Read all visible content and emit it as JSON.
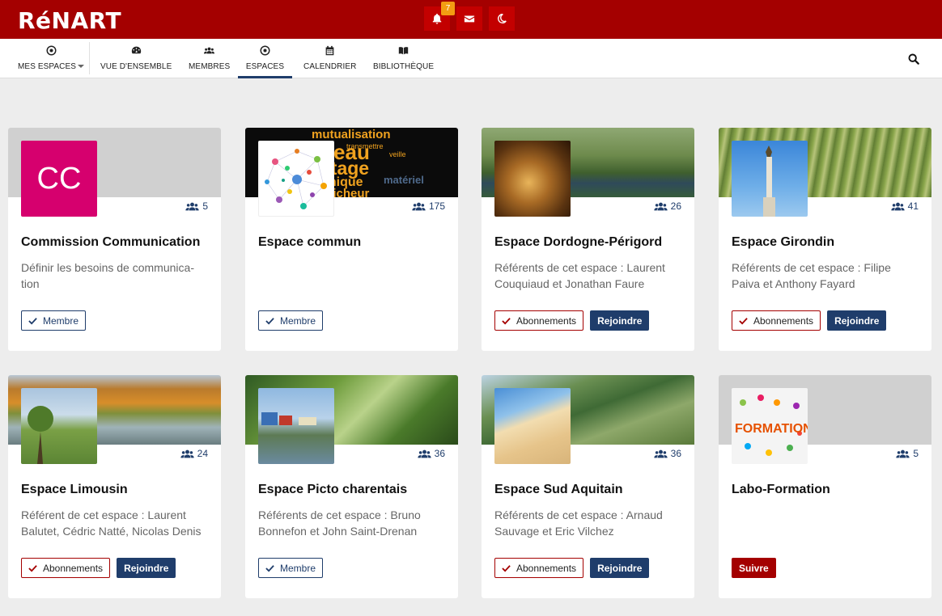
{
  "header": {
    "logo": "RéNART",
    "notifications_count": "7",
    "icons": [
      "bell-icon",
      "envelope-icon",
      "moon-icon",
      "search-icon"
    ]
  },
  "nav": {
    "mes_espaces": "MES ESPACES",
    "vue": "VUE D'ENSEMBLE",
    "membres": "MEMBRES",
    "espaces": "ESPACES",
    "calendrier": "CALENDRIER",
    "bibliotheque": "BIBLIOTHÈQUE"
  },
  "colors": {
    "brand_red": "#a40000",
    "navy": "#1f3d6b",
    "badge": "#f39c12"
  },
  "cards": [
    {
      "title": "Commission Communication",
      "count": "5",
      "initials": "CC",
      "desc": "Définir les besoins de communica-tion",
      "membre": "Membre"
    },
    {
      "title": "Espace commun",
      "count": "175",
      "membre": "Membre",
      "words": [
        "mutualisation",
        "transmettre",
        "réseau",
        "veille",
        "partage",
        "technique",
        "matériel",
        "défricheur"
      ]
    },
    {
      "title": "Espace Dordogne-Périgord",
      "count": "26",
      "desc": "Référents de cet espace : Laurent Couquiaud et Jonathan Faure",
      "abonnements": "Abonnements",
      "rejoindre": "Rejoindre"
    },
    {
      "title": "Espace Girondin",
      "count": "41",
      "desc": "Référents de cet espace : Filipe Paiva et Anthony Fayard",
      "abonnements": "Abonnements",
      "rejoindre": "Rejoindre"
    },
    {
      "title": "Espace Limousin",
      "count": "24",
      "desc": "Référent de cet espace : Laurent Balutet, Cédric Natté, Nicolas Denis",
      "abonnements": "Abonnements",
      "rejoindre": "Rejoindre"
    },
    {
      "title": "Espace Picto charentais",
      "count": "36",
      "desc": "Référents de cet espace : Bruno Bonnefon et John Saint-Drenan",
      "membre": "Membre"
    },
    {
      "title": "Espace Sud Aquitain",
      "count": "36",
      "desc": "Référents de cet espace : Arnaud Sauvage et Eric Vilchez",
      "abonnements": "Abonnements",
      "rejoindre": "Rejoindre"
    },
    {
      "title": "Labo-Formation",
      "count": "5",
      "suivre": "Suivre",
      "logo_text": "FORMATION"
    }
  ]
}
